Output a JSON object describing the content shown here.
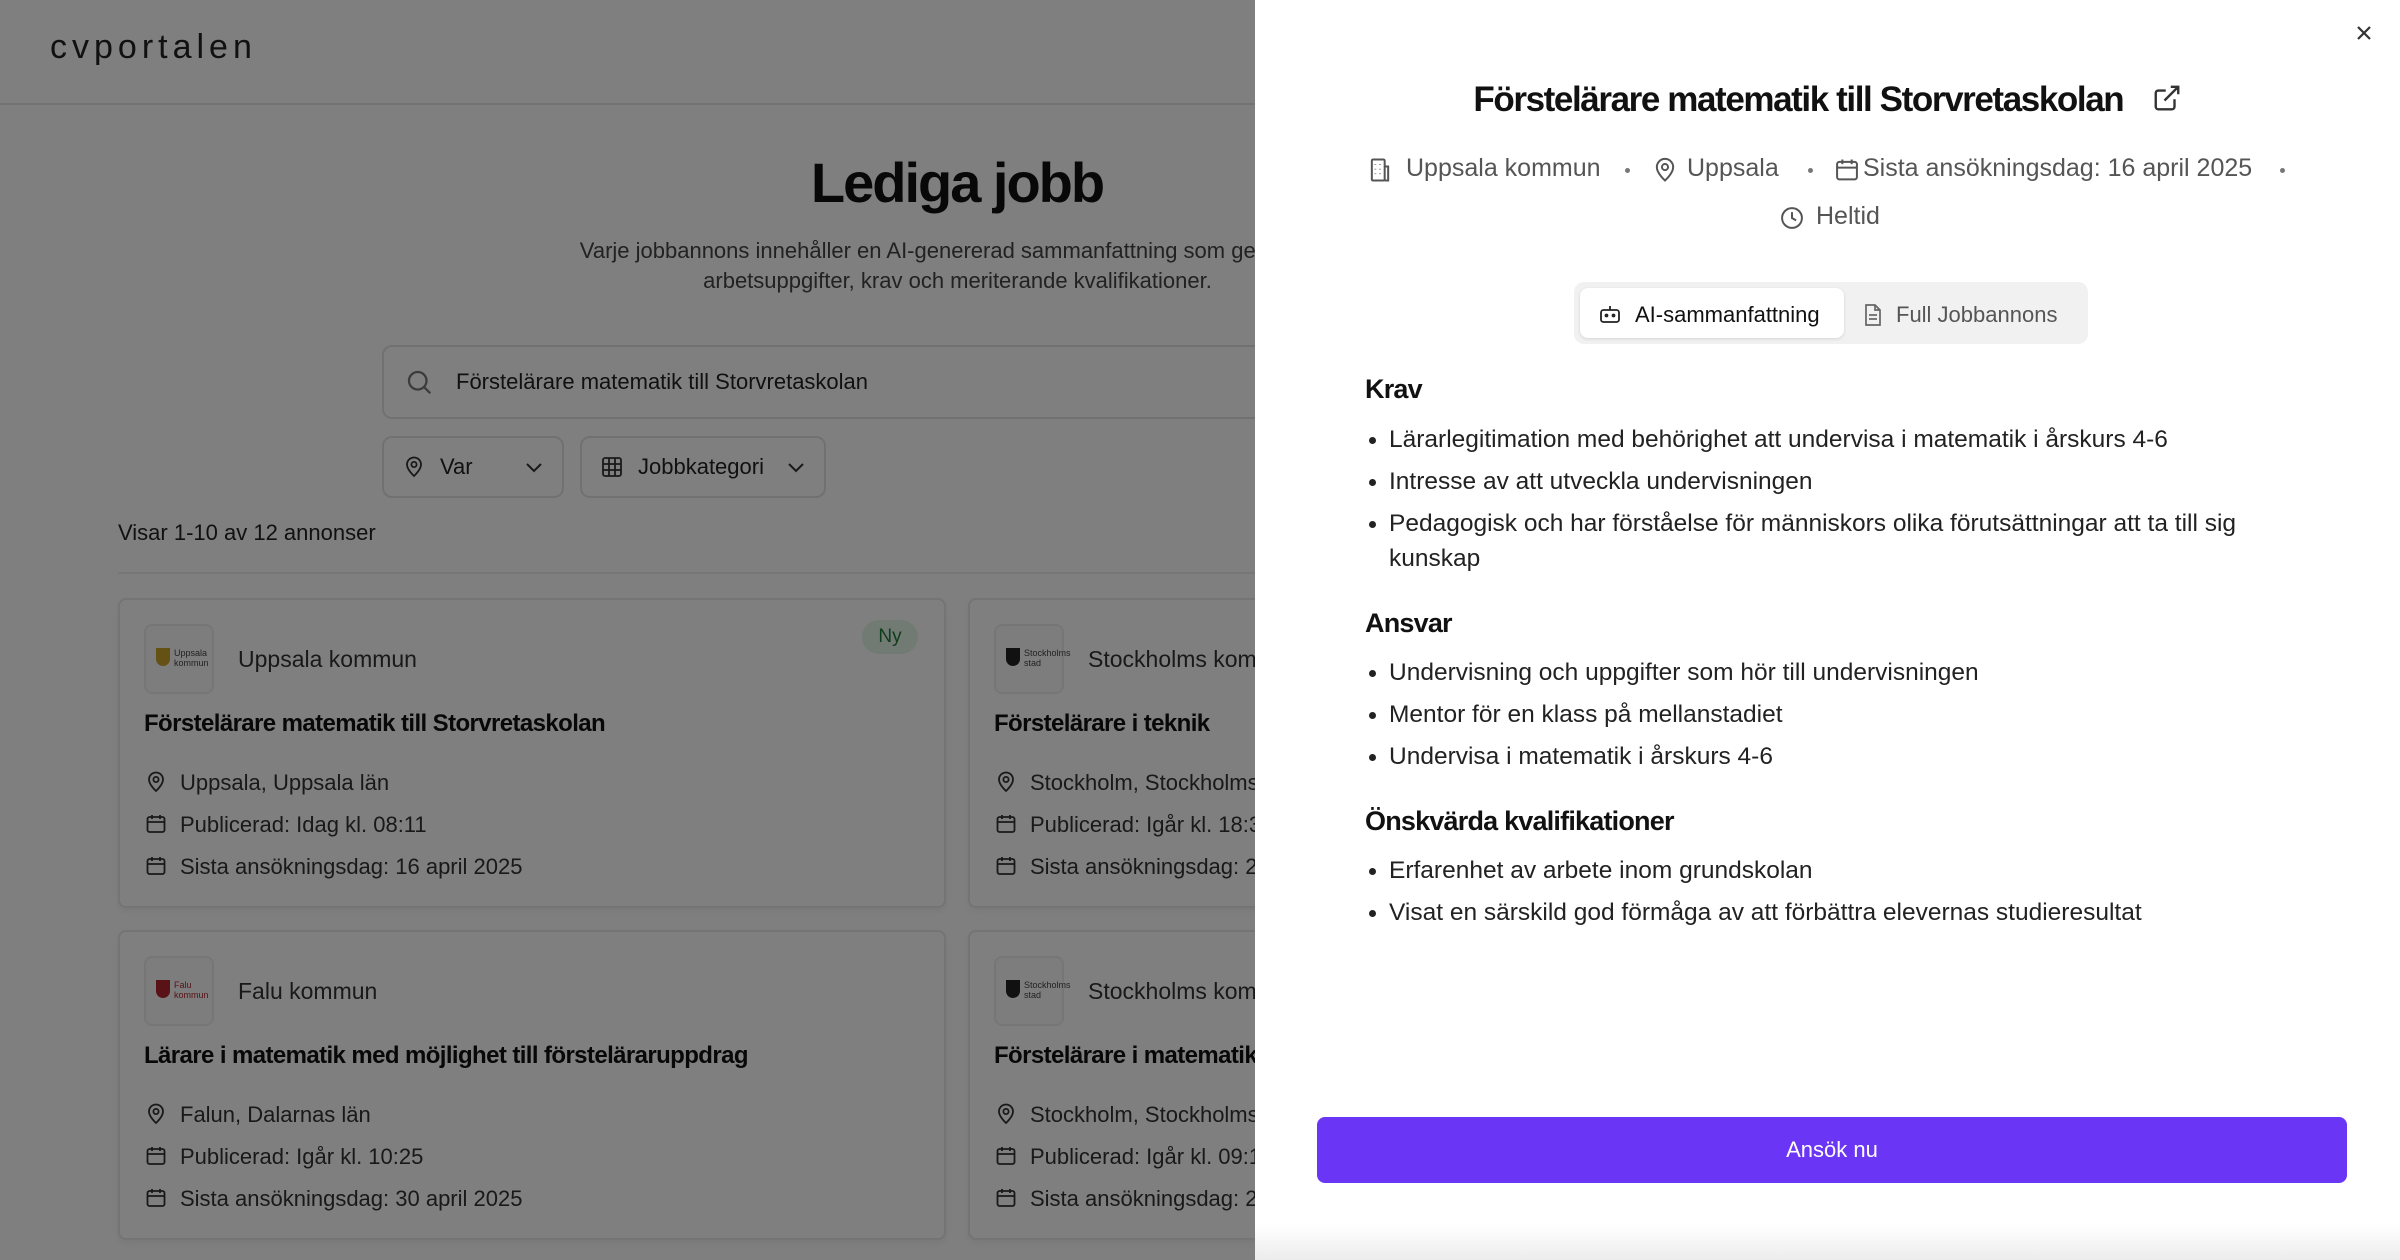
{
  "brand": {
    "logo": "cvportalen"
  },
  "hero": {
    "title": "Lediga jobb",
    "subtitle_line1": "Varje jobbannons innehåller en AI-genererad sammanfattning som ger en sna",
    "subtitle_line2": "arbetsuppgifter, krav och meriterande kvalifikationer."
  },
  "search": {
    "value": "Förstelärare matematik till Storvretaskolan"
  },
  "filters": {
    "where": "Var",
    "category": "Jobbkategori"
  },
  "results_text": "Visar 1-10 av 12 annonser",
  "cards": [
    {
      "company": "Uppsala kommun",
      "logo_text": "Uppsala kommun",
      "badge": "Ny",
      "title": "Förstelärare matematik till Storvretaskolan",
      "location": "Uppsala, Uppsala län",
      "published": "Publicerad: Idag kl. 08:11",
      "deadline": "Sista ansökningsdag: 16 april 2025"
    },
    {
      "company": "Stockholms kom",
      "logo_text": "Stockholms stad",
      "title": "Förstelärare i teknik",
      "location": "Stockholm, Stockholms",
      "published": "Publicerad: Igår kl. 18:3",
      "deadline": "Sista ansökningsdag: 2"
    },
    {
      "company": "Falu kommun",
      "logo_text": "Falu kommun",
      "title": "Lärare i matematik med möjlighet till förstelärаruppdrag",
      "location": "Falun, Dalarnas län",
      "published": "Publicerad: Igår kl. 10:25",
      "deadline": "Sista ansökningsdag: 30 april 2025"
    },
    {
      "company": "Stockholms kom",
      "logo_text": "Stockholms stad",
      "title": "Förstelärare i matematik",
      "location": "Stockholm, Stockholms",
      "published": "Publicerad: Igår kl. 09:1",
      "deadline": "Sista ansökningsdag: 2"
    }
  ],
  "drawer": {
    "title": "Förstelärare matematik till Storvretaskolan",
    "employer": "Uppsala kommun",
    "city": "Uppsala",
    "deadline": "Sista ansökningsdag: 16 april 2025",
    "employment_type": "Heltid",
    "tabs": {
      "ai": "AI-sammanfattning",
      "full": "Full Jobbannons",
      "active": "ai"
    },
    "sections": {
      "krav": {
        "heading": "Krav",
        "items": [
          "Lärarlegitimation med behörighet att undervisa i matematik i årskurs 4-6",
          "Intresse av att utveckla undervisningen",
          "Pedagogisk och har förståelse för människors olika förutsättningar att ta till sig kunskap"
        ]
      },
      "ansvar": {
        "heading": "Ansvar",
        "items": [
          "Undervisning och uppgifter som hör till undervisningen",
          "Mentor för en klass på mellanstadiet",
          "Undervisa i matematik i årskurs 4-6"
        ]
      },
      "onskvarda": {
        "heading": "Önskvärda kvalifikationer",
        "items": [
          "Erfarenhet av arbete inom grundskolan",
          "Visat en särskild god förmåga av att förbättra elevernas studieresultat"
        ]
      }
    },
    "apply_label": "Ansök nu"
  },
  "colors": {
    "primary": "#6b35f5",
    "badge_bg": "#e3f6e7",
    "badge_text": "#237a3a",
    "overlay": "rgba(0,0,0,0.5)"
  },
  "icons": [
    "search-icon",
    "location-pin-icon",
    "grid-icon",
    "chevron-down-icon",
    "calendar-icon",
    "building-icon",
    "clock-icon",
    "external-link-icon",
    "close-icon",
    "robot-icon",
    "document-icon"
  ]
}
